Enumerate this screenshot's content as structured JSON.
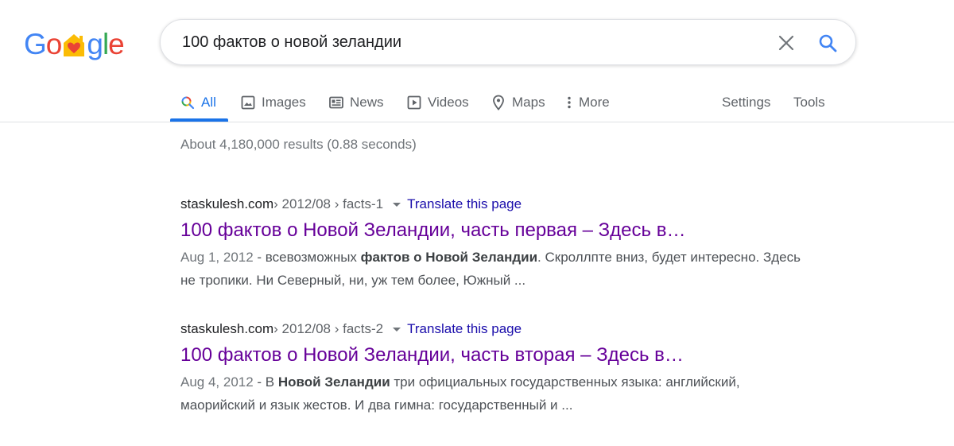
{
  "logo": {
    "letters": [
      "G",
      "o",
      "",
      "g",
      "l",
      "e"
    ],
    "colors": {
      "blue": "#4285f4",
      "red": "#ea4335",
      "yellow": "#fbbc05",
      "green": "#34a853"
    }
  },
  "search": {
    "query": "100 фактов о новой зеландии",
    "clear_icon": "close-icon",
    "submit_icon": "search-icon"
  },
  "tabs": [
    {
      "label": "All",
      "icon": "search-icon",
      "active": true
    },
    {
      "label": "Images",
      "icon": "image-icon"
    },
    {
      "label": "News",
      "icon": "news-icon"
    },
    {
      "label": "Videos",
      "icon": "video-icon"
    },
    {
      "label": "Maps",
      "icon": "map-pin-icon"
    },
    {
      "label": "More",
      "icon": "more-vert-icon"
    }
  ],
  "tools": {
    "settings": "Settings",
    "tools": "Tools"
  },
  "stats": "About 4,180,000 results (0.88 seconds)",
  "results": [
    {
      "domain": "staskulesh.com",
      "breadcrumb": " › 2012/08 › facts-1",
      "translate": "Translate this page",
      "title": "100 фактов о Новой Зеландии, часть первая – Здесь в…",
      "date": "Aug 1, 2012",
      "snippet_parts": [
        {
          "text": " - всевозможных ",
          "bold": false
        },
        {
          "text": "фактов о Новой Зеландии",
          "bold": true
        },
        {
          "text": ". Скроллпте вниз, будет интересно. Здесь не тропики. Ни Северный, ни, уж тем более, Южный ...",
          "bold": false
        }
      ]
    },
    {
      "domain": "staskulesh.com",
      "breadcrumb": " › 2012/08 › facts-2",
      "translate": "Translate this page",
      "title": "100 фактов о Новой Зеландии, часть вторая – Здесь в…",
      "date": "Aug 4, 2012",
      "snippet_parts": [
        {
          "text": " - В ",
          "bold": false
        },
        {
          "text": "Новой Зеландии",
          "bold": true
        },
        {
          "text": " три официальных государственных языка: английский, маорийский и язык жестов. И два гимна: государственный и ...",
          "bold": false
        }
      ]
    }
  ]
}
